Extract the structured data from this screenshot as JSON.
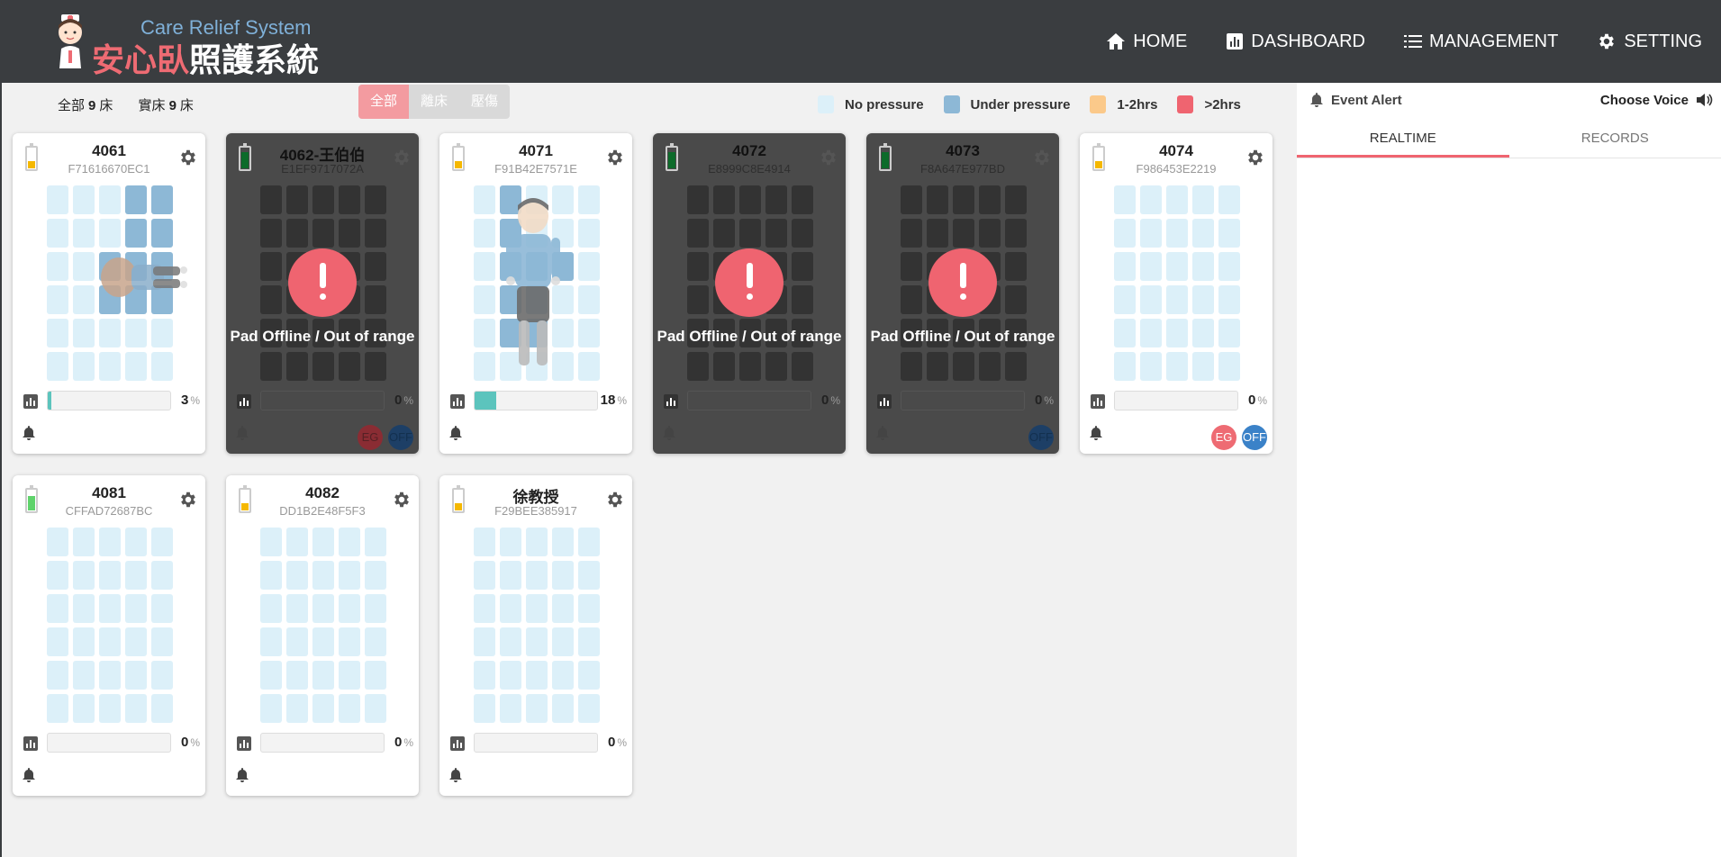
{
  "app": {
    "title_en": "Care Relief System",
    "title_zh_red": "安心臥",
    "title_zh": "照護系統"
  },
  "nav": [
    {
      "label": "HOME",
      "icon": "home-icon"
    },
    {
      "label": "DASHBOARD",
      "icon": "chart-bar-icon"
    },
    {
      "label": "MANAGEMENT",
      "icon": "list-icon"
    },
    {
      "label": "SETTING",
      "icon": "gear-icon"
    }
  ],
  "summary": {
    "all_label": "全部",
    "all_count": "9",
    "all_unit": "床",
    "real_label": "實床",
    "real_count": "9",
    "real_unit": "床"
  },
  "filters": [
    {
      "label": "全部",
      "active": true
    },
    {
      "label": "離床",
      "active": false
    },
    {
      "label": "壓傷",
      "active": false
    }
  ],
  "legend": [
    {
      "label": "No pressure",
      "color": "#dcf0f9"
    },
    {
      "label": "Under pressure",
      "color": "#8db8d6"
    },
    {
      "label": "1-2hrs",
      "color": "#fbc98a"
    },
    {
      "label": ">2hrs",
      "color": "#ef6470"
    }
  ],
  "beds": [
    {
      "title": "4061",
      "mac": "F71616670EC1",
      "offline": false,
      "battery": 0.35,
      "battery_color": "#f5b800",
      "progress": 3,
      "pct": "3",
      "badges": []
    },
    {
      "title": "4062-王伯伯",
      "mac": "E1EF9717072A",
      "offline": true,
      "battery": 0.75,
      "battery_color": "#0d6b2a",
      "progress": 0,
      "pct": "0",
      "badges": [
        "EG",
        "OFF"
      ]
    },
    {
      "title": "4071",
      "mac": "F91B42E7571E",
      "offline": false,
      "battery": 0.35,
      "battery_color": "#f5b800",
      "progress": 18,
      "pct": "18",
      "badges": []
    },
    {
      "title": "4072",
      "mac": "E8999C8E4914",
      "offline": true,
      "battery": 0.75,
      "battery_color": "#0d6b2a",
      "progress": 0,
      "pct": "0",
      "badges": []
    },
    {
      "title": "4073",
      "mac": "F8A647E977BD",
      "offline": true,
      "battery": 0.75,
      "battery_color": "#0d6b2a",
      "progress": 0,
      "pct": "0",
      "badges": [
        "OFF"
      ]
    },
    {
      "title": "4074",
      "mac": "F986453E2219",
      "offline": false,
      "battery": 0.35,
      "battery_color": "#f5b800",
      "progress": 0,
      "pct": "0",
      "badges": [
        "EG",
        "OFF"
      ]
    },
    {
      "title": "4081",
      "mac": "CFFAD72687BC",
      "offline": false,
      "battery": 0.65,
      "battery_color": "#5fd36b",
      "progress": 0,
      "pct": "0",
      "badges": []
    },
    {
      "title": "4082",
      "mac": "DD1B2E48F5F3",
      "offline": false,
      "battery": 0.35,
      "battery_color": "#f5b800",
      "progress": 0,
      "pct": "0",
      "badges": []
    },
    {
      "title": "徐教授",
      "mac": "F29BEE385917",
      "offline": false,
      "battery": 0.35,
      "battery_color": "#f5b800",
      "progress": 0,
      "pct": "0",
      "badges": []
    }
  ],
  "offline_text": "Pad Offline / Out of range",
  "pct_unit": "%",
  "right_panel": {
    "event_alert": "Event Alert",
    "choose_voice": "Choose Voice",
    "tabs": [
      {
        "label": "REALTIME",
        "active": true
      },
      {
        "label": "RECORDS",
        "active": false
      }
    ]
  }
}
